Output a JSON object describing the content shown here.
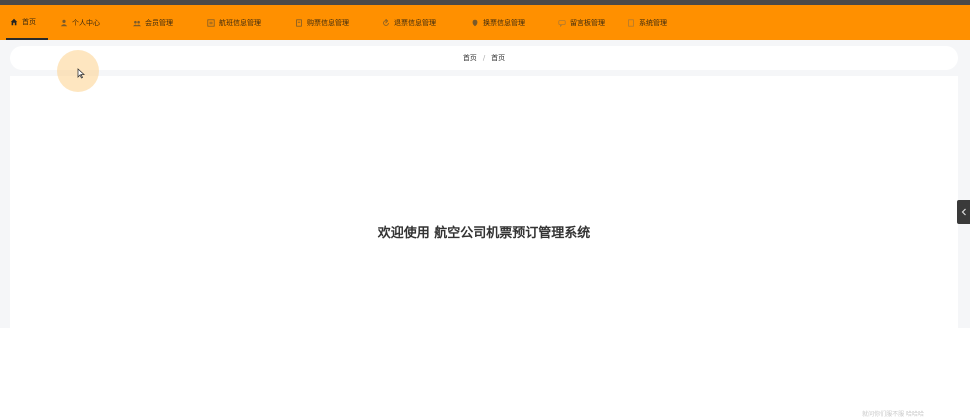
{
  "nav": {
    "items": [
      {
        "label": "首页",
        "icon": "home-icon",
        "active": true
      },
      {
        "label": "个人中心",
        "icon": "user-icon"
      },
      {
        "label": "会员管理",
        "icon": "group-icon"
      },
      {
        "label": "航班信息管理",
        "icon": "list-icon"
      },
      {
        "label": "购票信息管理",
        "icon": "doc-icon"
      },
      {
        "label": "退票信息管理",
        "icon": "return-icon"
      },
      {
        "label": "换票信息管理",
        "icon": "swap-icon"
      },
      {
        "label": "留言板管理",
        "icon": "message-icon"
      },
      {
        "label": "系统管理",
        "icon": "settings-icon"
      }
    ],
    "bg_color": "#ff9000"
  },
  "breadcrumb": {
    "home": "首页",
    "current": "首页"
  },
  "main": {
    "welcome": "欢迎使用 航空公司机票预订管理系统"
  },
  "watermark": "就问你们服不服 哈哈哈"
}
